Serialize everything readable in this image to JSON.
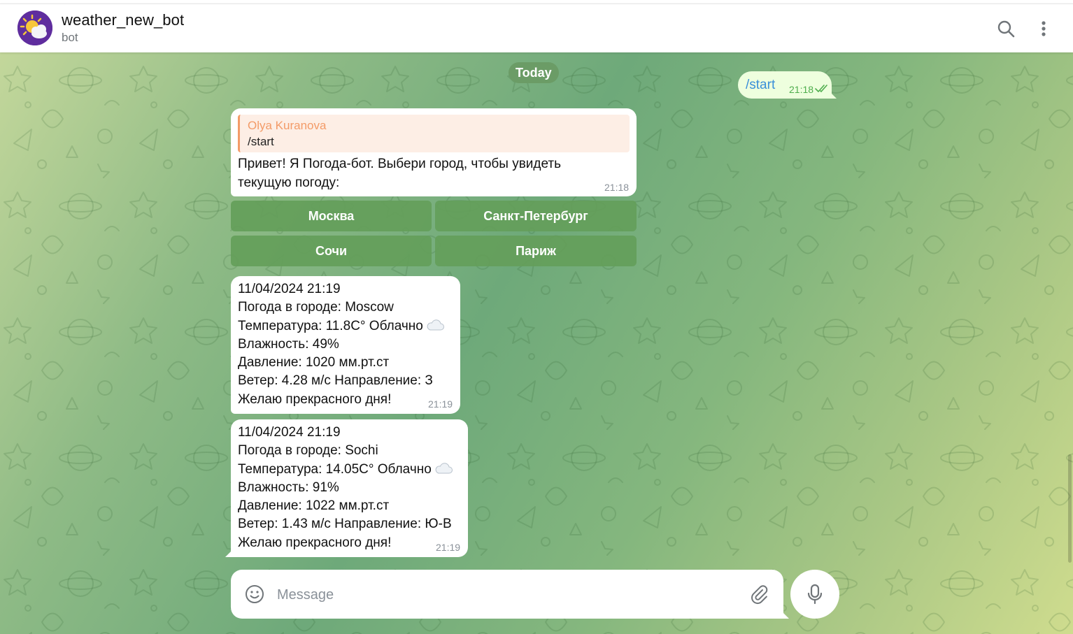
{
  "header": {
    "title": "weather_new_bot",
    "subtitle": "bot",
    "avatar_icon": "weather-sun-cloud-icon",
    "search_icon": "search-icon",
    "menu_icon": "more-vertical-icon"
  },
  "chat": {
    "date_separator": "Today",
    "outgoing": {
      "text": "/start",
      "time": "21:18",
      "status_icon": "double-check-icon"
    },
    "bot_reply": {
      "reply_to_author": "Olya Kuranova",
      "reply_to_text": "/start",
      "lines": [
        "Привет! Я Погода-бот. Выбери город, чтобы увидеть",
        "текущую погоду:"
      ],
      "time": "21:18"
    },
    "keyboard": {
      "buttons": [
        "Москва",
        "Санкт-Петербург",
        "Сочи",
        "Париж"
      ]
    },
    "weather_messages": [
      {
        "lines": [
          "11/04/2024 21:19",
          "Погода в городе: Moscow",
          "Температура: 11.8C° Облачно",
          "Влажность: 49%",
          "Давление: 1020 мм.рт.ст",
          "Ветер: 4.28 м/с Направление: З",
          "Желаю прекрасного дня!"
        ],
        "time": "21:19"
      },
      {
        "lines": [
          "11/04/2024 21:19",
          "Погода в городе: Sochi",
          "Температура: 14.05C° Облачно",
          "Влажность: 91%",
          "Давление: 1022 мм.рт.ст",
          "Ветер: 1.43 м/с Направление: Ю-В",
          "Желаю прекрасного дня!"
        ],
        "time": "21:19"
      }
    ]
  },
  "composer": {
    "placeholder": "Message",
    "value": "",
    "emoji_icon": "smile-icon",
    "attach_icon": "paperclip-icon",
    "mic_icon": "microphone-icon"
  },
  "colors": {
    "accent": "#3a8fd9",
    "outgoing_bubble": "#eeffde",
    "reply_accent": "#f39b68",
    "keyboard_button": "#649e5a",
    "date_pill": "#6b9c66",
    "check_green": "#4fae4e"
  }
}
